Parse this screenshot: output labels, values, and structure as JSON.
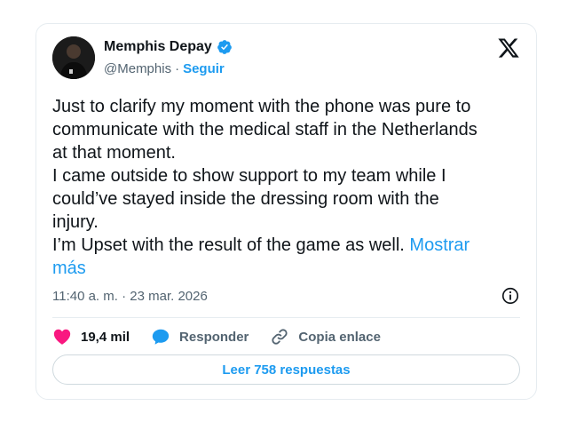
{
  "author": {
    "name": "Memphis Depay",
    "handle": "@Memphis",
    "separator": "·",
    "follow_label": "Seguir",
    "avatar_icon": "profile-photo",
    "verified_icon": "verified-badge-icon"
  },
  "platform_icon": "x-logo-icon",
  "tweet": {
    "text": "Just to clarify my moment with the phone was pure to\ncommunicate with the medical staff in the Netherlands\nat that moment.\nI came outside to show support to my team while I\ncould’ve stayed inside the dressing room with the\ninjury.\nI’m Upset with the result of the game as well. ",
    "show_more": "Mostrar\nmás"
  },
  "meta": {
    "timestamp": "11:40 a. m. · 23 mar. 2026",
    "info_icon": "info-icon"
  },
  "actions": {
    "like_count": "19,4 mil",
    "like_icon": "heart-icon",
    "reply_label": "Responder",
    "reply_icon": "speech-bubble-icon",
    "copy_label": "Copia enlace",
    "copy_icon": "link-icon"
  },
  "replies_button": "Leer 758 respuestas",
  "colors": {
    "accent": "#1d9bf0",
    "like": "#f91880",
    "text": "#0f1419",
    "secondary": "#536471",
    "border": "#e6ecf0"
  }
}
